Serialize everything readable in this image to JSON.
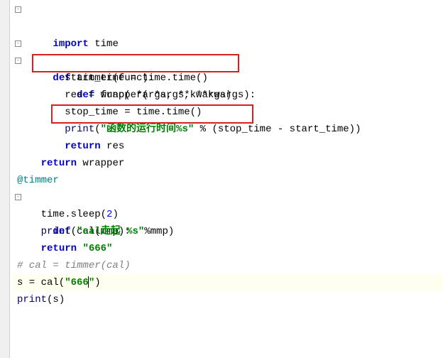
{
  "code": {
    "l1a": "import",
    "l1b": " time",
    "l2": "",
    "l3a": "def",
    "l3b": " timmer(func):",
    "l4a": "def",
    "l4b": " wrapper( *args, **kwargs):",
    "l5": "start_time = time.time()",
    "l6": "res = func( *args, **kwargs)",
    "l7": "stop_time = time.time()",
    "l8a": "print",
    "l8b": "(",
    "l8c": "\"函数的运行时间%s\"",
    "l8d": " % (stop_time - start_time))",
    "l9a": "return",
    "l9b": " res",
    "l10a": "return",
    "l10b": " wrapper",
    "l11": "@timmer",
    "l12a": "def",
    "l12b": " cal(mmp):",
    "l13a": "time.sleep(",
    "l13b": "2",
    "l13c": ")",
    "l14a": "print",
    "l14b": "(",
    "l14c": "\"cal走起 %s\"",
    "l14d": "%mmp)",
    "l15a": "return",
    "l15b": " ",
    "l15c": "\"666\"",
    "l16": "# cal = timmer(cal)",
    "l17a": "s = cal(",
    "l17b": "\"666",
    "l17c": "\"",
    "l17d": ")",
    "l18a": "print",
    "l18b": "(s)"
  }
}
